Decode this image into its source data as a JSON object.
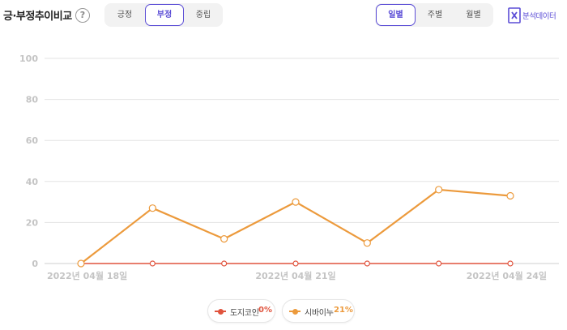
{
  "header": {
    "title": "긍·부정추이비교",
    "help_icon": "?",
    "sentiment_tabs": [
      {
        "label": "긍정",
        "active": false
      },
      {
        "label": "부정",
        "active": true
      },
      {
        "label": "중립",
        "active": false
      }
    ],
    "period_tabs": [
      {
        "label": "일별",
        "active": true
      },
      {
        "label": "주별",
        "active": false
      },
      {
        "label": "월별",
        "active": false
      }
    ],
    "report_button": {
      "icon": "excel-icon",
      "label": "분석데이터"
    }
  },
  "colors": {
    "accent": "#5b4dd6",
    "series_1": "#e0533d",
    "series_2": "#ec9a3c",
    "grid": "#e3e3e3",
    "tick": "#c4c4c4"
  },
  "chart_data": {
    "type": "line",
    "title": "",
    "xlabel": "",
    "ylabel": "",
    "ylim": [
      0,
      100
    ],
    "yticks": [
      0,
      20,
      40,
      60,
      80,
      100
    ],
    "x": [
      "2022-04-18",
      "2022-04-19",
      "2022-04-20",
      "2022-04-21",
      "2022-04-22",
      "2022-04-23",
      "2022-04-24"
    ],
    "xtick_labels": [
      {
        "index": 0,
        "label": "2022년 04월 18일"
      },
      {
        "index": 3,
        "label": "2022년 04월 21일"
      },
      {
        "index": 6,
        "label": "2022년 04월 24일"
      }
    ],
    "grid": true,
    "legend_position": "bottom-center",
    "series": [
      {
        "name": "도지코인",
        "legend_value": "0%",
        "values": [
          0,
          0,
          0,
          0,
          0,
          0,
          0
        ]
      },
      {
        "name": "시바이누",
        "legend_value": "21%",
        "values": [
          0,
          27,
          12,
          30,
          10,
          36,
          33
        ]
      }
    ]
  }
}
